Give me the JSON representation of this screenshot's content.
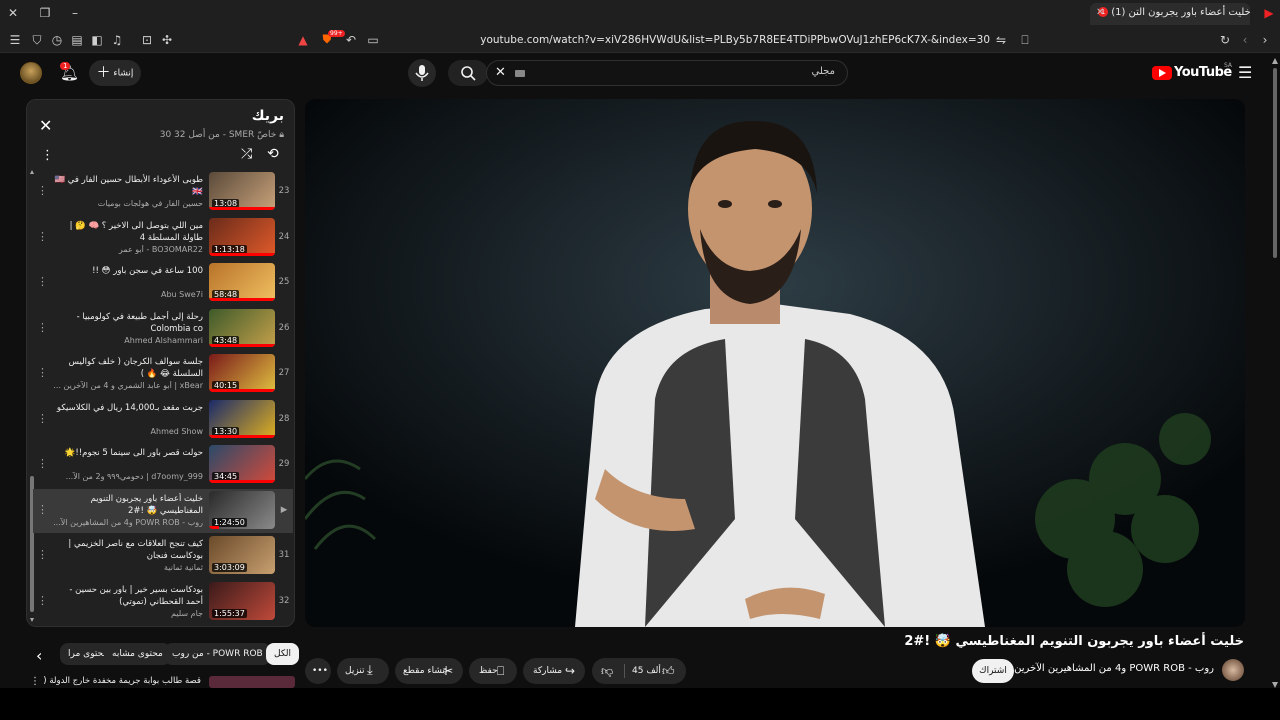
{
  "browser": {
    "tab_title": "(1) خليت أعضاء باور يجربون التن",
    "tab_badge": "1",
    "url": "youtube.com/watch?v=xiV286HVWdU&list=PLBy5b7R8EE4TDiPPbwOVuJ1zhEP6cK7X-&index=30",
    "shield_badge": "99+"
  },
  "header": {
    "logo_text": "YouTube",
    "region": "SA",
    "search_value": "مجلي",
    "create_label": "إنشاء",
    "notification_count": "1"
  },
  "playlist": {
    "title": "بريك",
    "privacy": "خاصّ",
    "owner": "SMER",
    "position": "30 من أصل 32",
    "items": [
      {
        "index": "23",
        "title": "طوبى الأعوداء الأبطال حسين الفار في 🇺🇸🇬🇧",
        "channel": "حسين الفار في هولجات بوميات",
        "duration": "13:08",
        "progress": 1.0,
        "colors": [
          "#5a4a3a",
          "#c9a27a"
        ]
      },
      {
        "index": "24",
        "title": "مين اللي بتوصل الى الاخير ؟ 🧠 🤔 | طاولة المسلطة 4",
        "channel": "BO3OMAR22 - أبو عمر",
        "duration": "1:13:18",
        "progress": 1.0,
        "colors": [
          "#6a2b1a",
          "#e05a2a"
        ]
      },
      {
        "index": "25",
        "title": "100 ساعة في سجن باور 😳 !!",
        "channel": "Abu Swe7i",
        "duration": "58:48",
        "progress": 1.0,
        "colors": [
          "#b8732a",
          "#f0c060"
        ]
      },
      {
        "index": "26",
        "title": "رحلة إلى أجمل طبيعة في كولومبيا - Colombia co",
        "channel": "Ahmed Alshammari",
        "duration": "43:48",
        "progress": 1.0,
        "colors": [
          "#3e5a2a",
          "#c4a04a"
        ]
      },
      {
        "index": "27",
        "title": "جلسة سوالف الكرجان ( خلف كواليس السلسلة 😂 🔥 )",
        "channel": "xBear | أبو عابد الشمري و 4 من الآخرين ...",
        "duration": "40:15",
        "progress": 1.0,
        "colors": [
          "#7a1a1a",
          "#e0c040"
        ]
      },
      {
        "index": "28",
        "title": "جربت مقعد بـ14,000 ريال في الكلاسيكو",
        "channel": "Ahmed Show",
        "duration": "13:30",
        "progress": 1.0,
        "colors": [
          "#1a2a6a",
          "#e0b020"
        ]
      },
      {
        "index": "29",
        "title": "حولت قصر باور الى سينما 5 نجوم!!🌟",
        "channel": "d7oomy_999 | دحومي٩٩٩ و2 من الآ...",
        "duration": "34:45",
        "progress": 1.0,
        "colors": [
          "#2a4a6a",
          "#d44a3a"
        ]
      },
      {
        "index": "▶",
        "title": "خليت أعضاء باور يجربون التنويم المغناطيسي 🤯 !#2",
        "channel": "روب - POWR ROB و4 من المشاهيرين الآ...",
        "duration": "1:24:50",
        "progress": 0.15,
        "colors": [
          "#2a2a2a",
          "#8a8a8a"
        ],
        "active": true
      },
      {
        "index": "31",
        "title": "كيف تنجح العلاقات مع ناصر الخزيمي | بودكاست فنجان",
        "channel": "ثمانية ثمانية",
        "duration": "3:03:09",
        "progress": 0,
        "colors": [
          "#6a4a2a",
          "#c8a070"
        ]
      },
      {
        "index": "32",
        "title": "بودكاست بسير خير | باور بين حسين - أحمد القحطاني (تموتي)",
        "channel": "جام سليم",
        "duration": "1:55:37",
        "progress": 0,
        "colors": [
          "#3a1a1a",
          "#c04a3a"
        ]
      }
    ]
  },
  "video": {
    "title": "خليت أعضاء باور يجربون التنويم المغناطيسي 🤯 !#2",
    "channel": "روب - POWR ROB و4 من المشاهيرين الآخرين",
    "subscribe_label": "اشتراك",
    "likes": "45 ألف",
    "share_label": "مشاركة",
    "save_label": "حفظ",
    "clip_label": "إنشاء مقطع",
    "download_label": "تنزيل"
  },
  "chips": {
    "all": "الكل",
    "from_channel": "من روب - POWR ROB",
    "related": "محتوى مشابه",
    "more": "محتوى مرا..."
  },
  "next_item": {
    "title": "قصة طالب بوابة جريمة مخفدة خارج الدولة ("
  }
}
